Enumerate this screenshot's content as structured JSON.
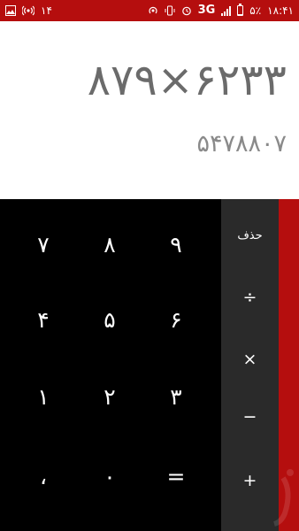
{
  "status_bar": {
    "notification_count": "۱۴",
    "network": "3G",
    "battery": "۵٪",
    "time": "۱۸:۴۱"
  },
  "display": {
    "expression": "۸۷۹×۶۲۳۳",
    "result": "۵۴۷۸۸۰۷"
  },
  "keypad": {
    "keys": [
      "۷",
      "۸",
      "۹",
      "۴",
      "۵",
      "۶",
      "۱",
      "۲",
      "۳",
      "،",
      "۰",
      "="
    ]
  },
  "operators": {
    "delete": "حذف",
    "divide": "÷",
    "multiply": "×",
    "subtract": "−",
    "add": "+"
  },
  "colors": {
    "accent": "#b50e0e",
    "keypad_bg": "#000000",
    "operator_bg": "#2a2a2a",
    "display_text": "#6b6b6b"
  }
}
